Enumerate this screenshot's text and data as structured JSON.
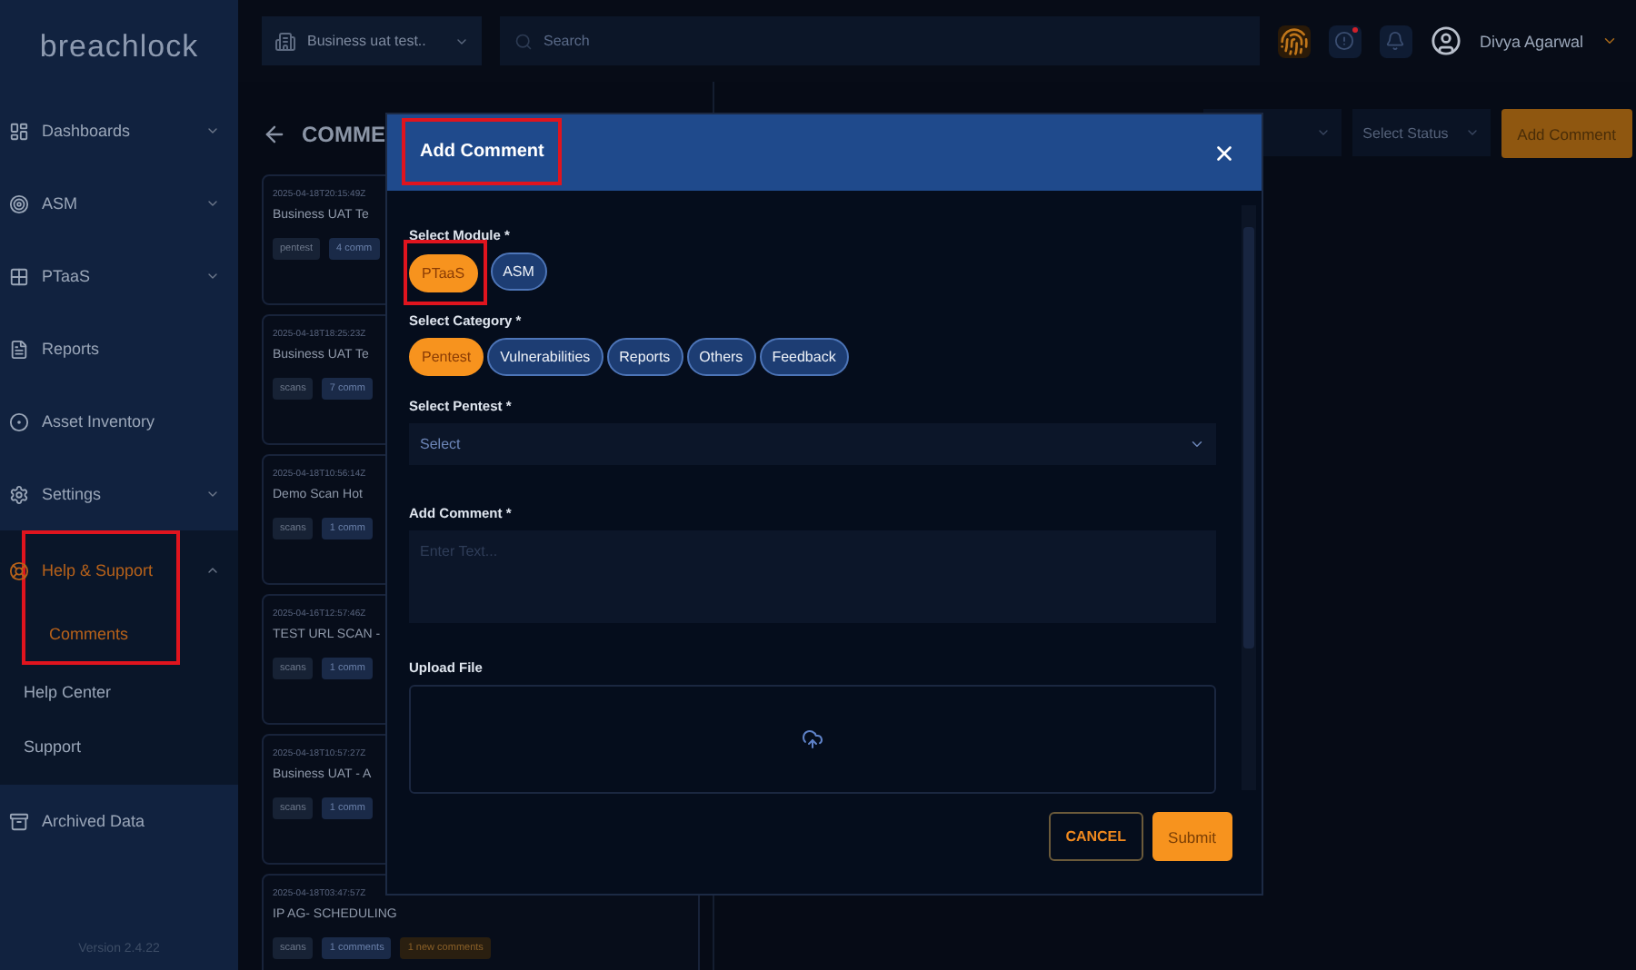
{
  "sidebar": {
    "logo": "breachlock",
    "items": [
      {
        "label": "Dashboards",
        "expanded": false,
        "selected": false
      },
      {
        "label": "ASM",
        "expanded": false,
        "selected": false
      },
      {
        "label": "PTaaS",
        "expanded": false,
        "selected": false
      },
      {
        "label": "Reports",
        "selected": false
      },
      {
        "label": "Asset Inventory",
        "selected": false
      },
      {
        "label": "Settings",
        "expanded": false,
        "selected": false
      },
      {
        "label": "Help & Support",
        "expanded": true,
        "selected": true,
        "highlighted": true,
        "children": [
          {
            "label": "Comments",
            "selected": true,
            "highlighted": true
          },
          {
            "label": "Help Center",
            "selected": false
          },
          {
            "label": "Support",
            "selected": false
          }
        ]
      },
      {
        "label": "Archived Data",
        "selected": false
      }
    ],
    "version": "Version 2.4.22"
  },
  "topbar": {
    "org_selector": "Business uat test..",
    "search": {
      "placeholder": "Search"
    },
    "user": "Divya Agarwal"
  },
  "page": {
    "title": "COMME",
    "filters": [
      {
        "kind": "blank"
      },
      {
        "kind": "status",
        "placeholder": "Select Status"
      }
    ],
    "add_button": "Add Comment",
    "cards": [
      {
        "date": "2025-04-18T20:15:49Z",
        "title": "Business UAT Te",
        "tags": [
          {
            "text": "pentest",
            "kind": "type"
          },
          {
            "text": "4 comm",
            "kind": "count"
          }
        ]
      },
      {
        "date": "2025-04-18T18:25:23Z",
        "title": "Business UAT Te",
        "tags": [
          {
            "text": "scans",
            "kind": "type"
          },
          {
            "text": "7 comm",
            "kind": "count"
          }
        ]
      },
      {
        "date": "2025-04-18T10:56:14Z",
        "title": "Demo Scan Hot",
        "tags": [
          {
            "text": "scans",
            "kind": "type"
          },
          {
            "text": "1 comm",
            "kind": "count"
          }
        ]
      },
      {
        "date": "2025-04-16T12:57:46Z",
        "title": "TEST URL SCAN -",
        "tags": [
          {
            "text": "scans",
            "kind": "type"
          },
          {
            "text": "1 comm",
            "kind": "count"
          }
        ]
      },
      {
        "date": "2025-04-18T10:57:27Z",
        "title": "Business UAT - A",
        "tags": [
          {
            "text": "scans",
            "kind": "type"
          },
          {
            "text": "1 comm",
            "kind": "count"
          }
        ]
      },
      {
        "date": "2025-04-18T03:47:57Z",
        "title": "IP AG- SCHEDULING",
        "tags": [
          {
            "text": "scans",
            "kind": "type"
          },
          {
            "text": "1 comments",
            "kind": "count"
          },
          {
            "text": "1 new comments",
            "kind": "new"
          }
        ]
      }
    ]
  },
  "modal": {
    "title": "Add Comment",
    "title_highlighted": true,
    "module": {
      "label": "Select Module *",
      "options": [
        {
          "label": "PTaaS",
          "selected": true,
          "highlighted": true
        },
        {
          "label": "ASM",
          "selected": false
        }
      ]
    },
    "category": {
      "label": "Select Category *",
      "options": [
        {
          "label": "Pentest",
          "selected": true
        },
        {
          "label": "Vulnerabilities",
          "selected": false
        },
        {
          "label": "Reports",
          "selected": false
        },
        {
          "label": "Others",
          "selected": false
        },
        {
          "label": "Feedback",
          "selected": false
        }
      ]
    },
    "pentest": {
      "label": "Select Pentest *",
      "placeholder": "Select"
    },
    "comment": {
      "label": "Add Comment *",
      "placeholder": "Enter Text..."
    },
    "upload": {
      "label": "Upload File"
    },
    "cancel": "CANCEL",
    "submit": "Submit"
  }
}
